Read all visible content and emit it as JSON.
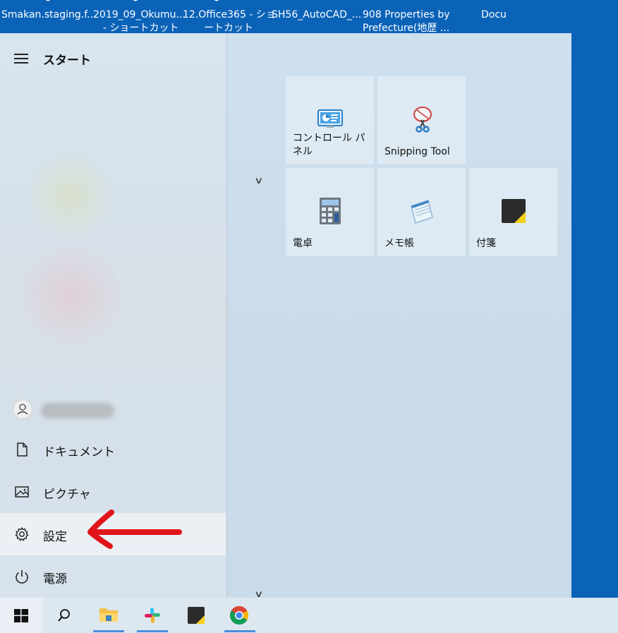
{
  "desktop": {
    "icons": [
      {
        "label": "Smakan.staging.f..."
      },
      {
        "label": "2019_09_Okumu...",
        "label2": "- ショートカット"
      },
      {
        "label": "12.Office365 - ショ",
        "label2": "ートカット"
      },
      {
        "label": "SH56_AutoCAD_..."
      },
      {
        "label": "908 Properties by",
        "label2": "Prefecture(地歴 ..."
      },
      {
        "label": "Docu"
      }
    ]
  },
  "start_menu": {
    "title": "スタート",
    "nav": [
      {
        "label": "ドキュメント",
        "icon": "document-icon"
      },
      {
        "label": "ピクチャ",
        "icon": "pictures-icon"
      },
      {
        "label": "設定",
        "icon": "gear-icon"
      },
      {
        "label": "電源",
        "icon": "power-icon"
      }
    ],
    "tiles": [
      {
        "label": "コントロール パネル",
        "icon": "control-panel-icon"
      },
      {
        "label": "Snipping Tool",
        "icon": "snipping-tool-icon"
      },
      {
        "label": "電卓",
        "icon": "calculator-icon"
      },
      {
        "label": "メモ帳",
        "icon": "notepad-icon"
      },
      {
        "label": "付箋",
        "icon": "sticky-notes-icon"
      }
    ]
  },
  "taskbar": {
    "items": [
      {
        "icon": "windows-start-icon"
      },
      {
        "icon": "search-icon"
      },
      {
        "icon": "file-explorer-icon"
      },
      {
        "icon": "slack-icon"
      },
      {
        "icon": "sticky-notes-icon"
      },
      {
        "icon": "chrome-icon"
      }
    ]
  },
  "colors": {
    "desktop": "#0b63b8",
    "accent": "#4a8fd8",
    "annotation_arrow": "#e0151b"
  }
}
